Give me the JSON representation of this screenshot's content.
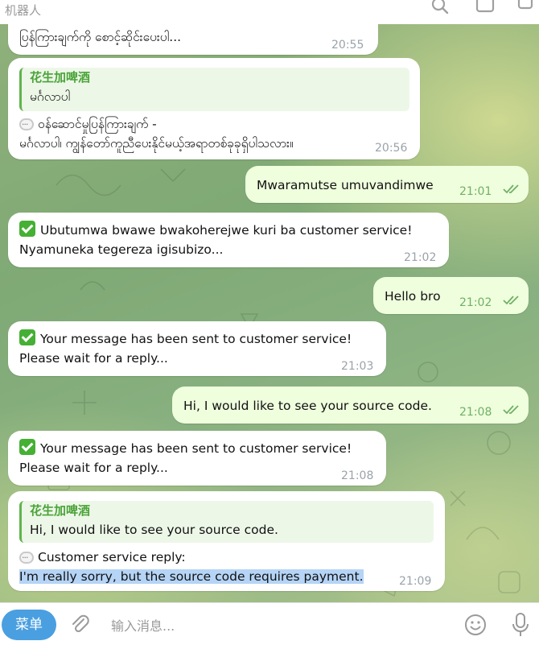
{
  "header": {
    "title": "机器人"
  },
  "quote_sender": "花生加啤酒",
  "messages": [
    {
      "id": "m1",
      "type": "incoming",
      "lines": [
        "ပြန်ကြားချက်ကို စောင့်ဆိုင်းပေးပါ..."
      ],
      "time": "20:55"
    },
    {
      "id": "m2",
      "type": "incoming",
      "quote": {
        "name": "花生加啤酒",
        "text": "မင်္ဂလာပါ"
      },
      "lines": [
        "ဝန်ဆောင်မှုပြန်ကြားချက် -",
        "မင်္ဂလာပါ၊ ကျွန်တော်ကူညီပေးနိုင်မယ့်အရာတစ်ခုခုရှိပါသလား။"
      ],
      "time": "20:56"
    },
    {
      "id": "m3",
      "type": "outgoing",
      "lines": [
        "Mwaramutse umuvandimwe"
      ],
      "time": "21:01"
    },
    {
      "id": "m4",
      "type": "incoming",
      "lines": [
        "Ubutumwa bwawe bwakoherejwe kuri ba customer service!",
        "Nyamuneka tegereza igisubizo..."
      ],
      "time": "21:02"
    },
    {
      "id": "m5",
      "type": "outgoing",
      "lines": [
        "Hello bro"
      ],
      "time": "21:02"
    },
    {
      "id": "m6",
      "type": "incoming",
      "lines": [
        "Your message has been sent to customer service!",
        "Please wait for a reply..."
      ],
      "time": "21:03"
    },
    {
      "id": "m7",
      "type": "outgoing",
      "lines": [
        "Hi, I would like to see your source code."
      ],
      "time": "21:08"
    },
    {
      "id": "m8",
      "type": "incoming",
      "lines": [
        "Your message has been sent to customer service!",
        "Please wait for a reply..."
      ],
      "time": "21:08"
    },
    {
      "id": "m9",
      "type": "incoming",
      "quote": {
        "name": "花生加啤酒",
        "text": "Hi, I would like to see your source code."
      },
      "lines": [
        "Customer service reply:",
        "I'm really sorry, but the source code requires payment."
      ],
      "time": "21:09"
    }
  ],
  "composer": {
    "menu_label": "菜单",
    "placeholder": "输入消息..."
  },
  "icons": {
    "search": "search-icon",
    "window": "window-icon",
    "attach": "paperclip-icon",
    "emoji": "emoji-icon",
    "mic": "microphone-icon",
    "read": "double-check-icon",
    "sent_ok": "check-mark-emoji",
    "speech": "speech-bubble-emoji"
  },
  "colors": {
    "outgoing_bubble": "#effedd",
    "accent": "#4a9fe0",
    "quote_name": "#4aa338",
    "highlight": "#b5d4f6"
  }
}
